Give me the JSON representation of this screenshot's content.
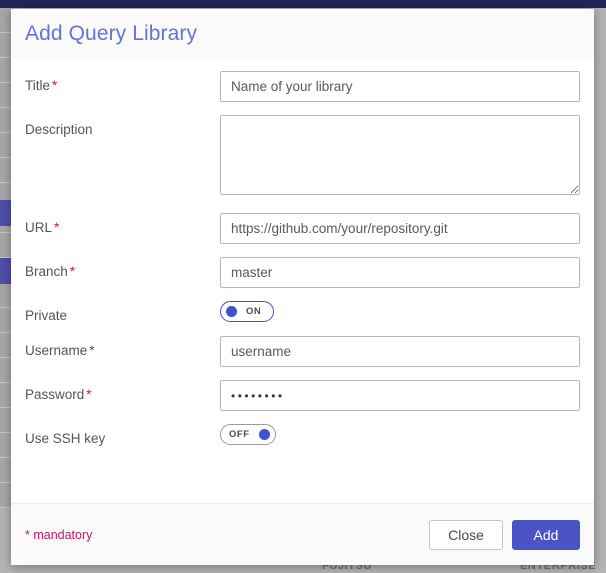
{
  "backdrop": {
    "footer_labels": [
      "FUJITSU",
      "ENTERPRISE"
    ]
  },
  "modal": {
    "title": "Add Query Library",
    "fields": [
      {
        "id": "title",
        "label": "Title",
        "required": true,
        "type": "text",
        "value": "",
        "placeholder": "Name of your library"
      },
      {
        "id": "description",
        "label": "Description",
        "required": false,
        "type": "textarea",
        "value": "",
        "placeholder": ""
      },
      {
        "id": "url",
        "label": "URL",
        "required": true,
        "type": "text",
        "value": "",
        "placeholder": "https://github.com/your/repository.git"
      },
      {
        "id": "branch",
        "label": "Branch",
        "required": true,
        "type": "text",
        "value": "",
        "placeholder": "master"
      },
      {
        "id": "private",
        "label": "Private",
        "required": false,
        "type": "toggle",
        "state": "on",
        "state_label": "ON"
      },
      {
        "id": "username",
        "label": "Username",
        "required": true,
        "type": "text",
        "value": "",
        "placeholder": "username"
      },
      {
        "id": "password",
        "label": "Password",
        "required": true,
        "type": "password",
        "value": "••••••••",
        "placeholder": ""
      },
      {
        "id": "use-ssh-key",
        "label": "Use SSH key",
        "required": false,
        "type": "toggle",
        "state": "off",
        "state_label": "OFF"
      }
    ],
    "required_marker": "*",
    "footer": {
      "mandatory_note": "* mandatory",
      "close_label": "Close",
      "add_label": "Add"
    }
  },
  "colors": {
    "title": "#6473d8",
    "accent": "#4a54c4",
    "required": "#c2185b",
    "topbar": "#232455"
  }
}
